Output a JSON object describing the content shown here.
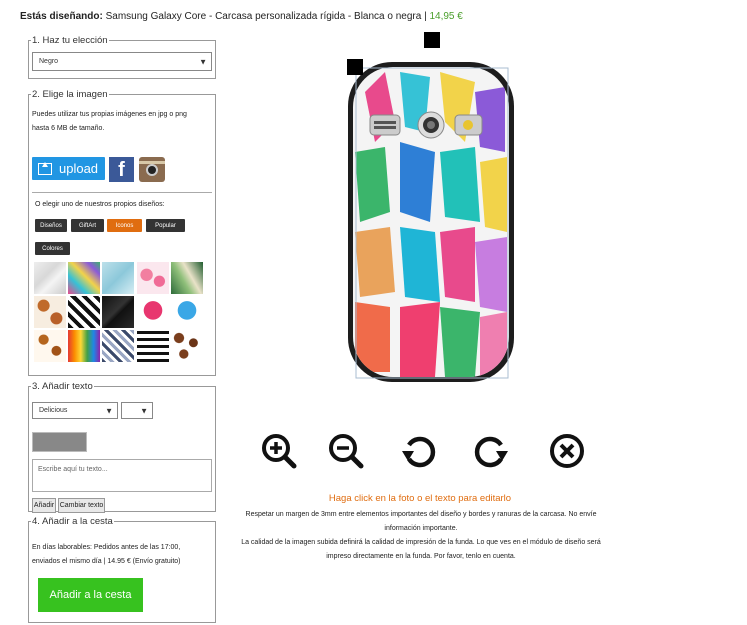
{
  "header": {
    "prefix": "Estás diseñando:",
    "product": "Samsung Galaxy Core - Carcasa personalizada rígida - Blanca o negra |",
    "price": "14,95 €"
  },
  "step1": {
    "legend": "1. Haz tu elección",
    "select_value": "Negro"
  },
  "step2": {
    "legend": "2. Elige la imagen",
    "hint_line1": "Puedes utilizar tus propias imágenes en jpg o png",
    "hint_line2": "hasta 6 MB de tamaño.",
    "upload_label": "upload",
    "facebook_label": "f",
    "or_text": "O elegir uno de nuestros propios diseños:",
    "categories": [
      "Diseños",
      "GiftArt",
      "Iconos",
      "Popular",
      "Colores"
    ],
    "active_category": "Popular",
    "thumbnails": [
      "marble",
      "pineapples",
      "light-blue-marble",
      "flamingos",
      "tropical-leaves",
      "cacti",
      "chevron-black",
      "black-marble",
      "pink-heart",
      "blue-heart",
      "hot-dogs",
      "paint-drips",
      "chevron-pastel",
      "brush-stripes",
      "coffee-beans"
    ]
  },
  "step3": {
    "legend": "3. Añadir texto",
    "font_value": "Delicious",
    "size_value": "",
    "text_placeholder": "Escribe aquí tu texto...",
    "add_button": "Añadir",
    "change_button": "Cambiar texto"
  },
  "step4": {
    "legend": "4. Añadir a la cesta",
    "line1": "En días laborables: Pedidos antes de las 17:00,",
    "line2": "enviados el mismo día | 14.95 € (Envío gratuito)",
    "cart_button": "Añadir a la cesta"
  },
  "tools": [
    "zoom-in-icon",
    "zoom-out-icon",
    "rotate-left-icon",
    "rotate-right-icon",
    "delete-icon"
  ],
  "editor": {
    "click_text": "Haga click en la foto o el texto para editarlo",
    "info1": "Respetar un margen de 3mm entre elementos importantes del diseño y bordes y ranuras de la carcasa. No envíe",
    "info2": "información importante.",
    "info3": "La calidad de la imagen subida definirá la calidad de impresión de la funda. Lo que ves en el módulo de diseño será",
    "info4": "impreso directamente en la funda. Por favor, tenlo en cuenta."
  },
  "colors": {
    "accent_orange": "#e06d10",
    "cart_green": "#37c21f",
    "upload_blue": "#2196e3",
    "price_green": "#4a9e2b"
  }
}
